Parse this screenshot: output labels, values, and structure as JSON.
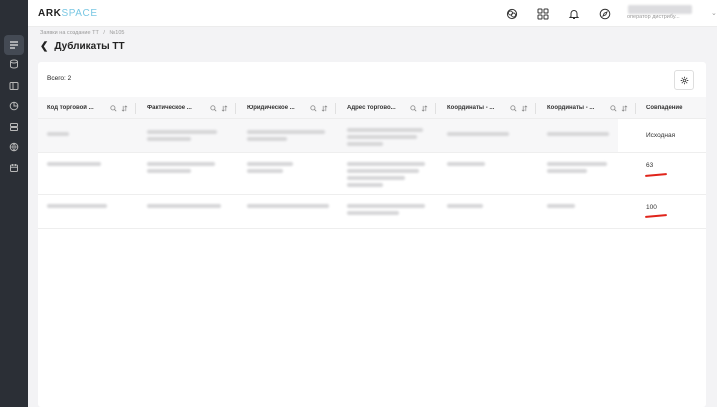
{
  "app": {
    "logo_main": "ARK",
    "logo_accent": "SPACE"
  },
  "user": {
    "role": "оператор дистрибу..."
  },
  "breadcrumb": [
    "Заявки на создание ТТ",
    "/",
    "№105"
  ],
  "page": {
    "title": "Дубликаты ТТ",
    "count_label": "Всего: 2"
  },
  "table": {
    "columns": [
      "Код торговой ...",
      "Фактическое ...",
      "Юридическое ...",
      "Адрес торгово...",
      "Координаты - ...",
      "Координаты - ...",
      "Совпадение"
    ],
    "rows": [
      {
        "match": "Исходная"
      },
      {
        "match": "63"
      },
      {
        "match": "100"
      }
    ]
  },
  "colors": {
    "sidebar": "#2b2f36",
    "logo_accent": "#79c7e3",
    "annotation": "#e0241b"
  },
  "icons": {
    "sidebar": [
      "list-icon",
      "database-icon",
      "layout-icon",
      "pie-chart-icon",
      "stack-icon",
      "globe-icon",
      "calendar-icon"
    ],
    "header": [
      "chat-icon",
      "apps-icon",
      "bell-icon",
      "compass-icon"
    ]
  }
}
